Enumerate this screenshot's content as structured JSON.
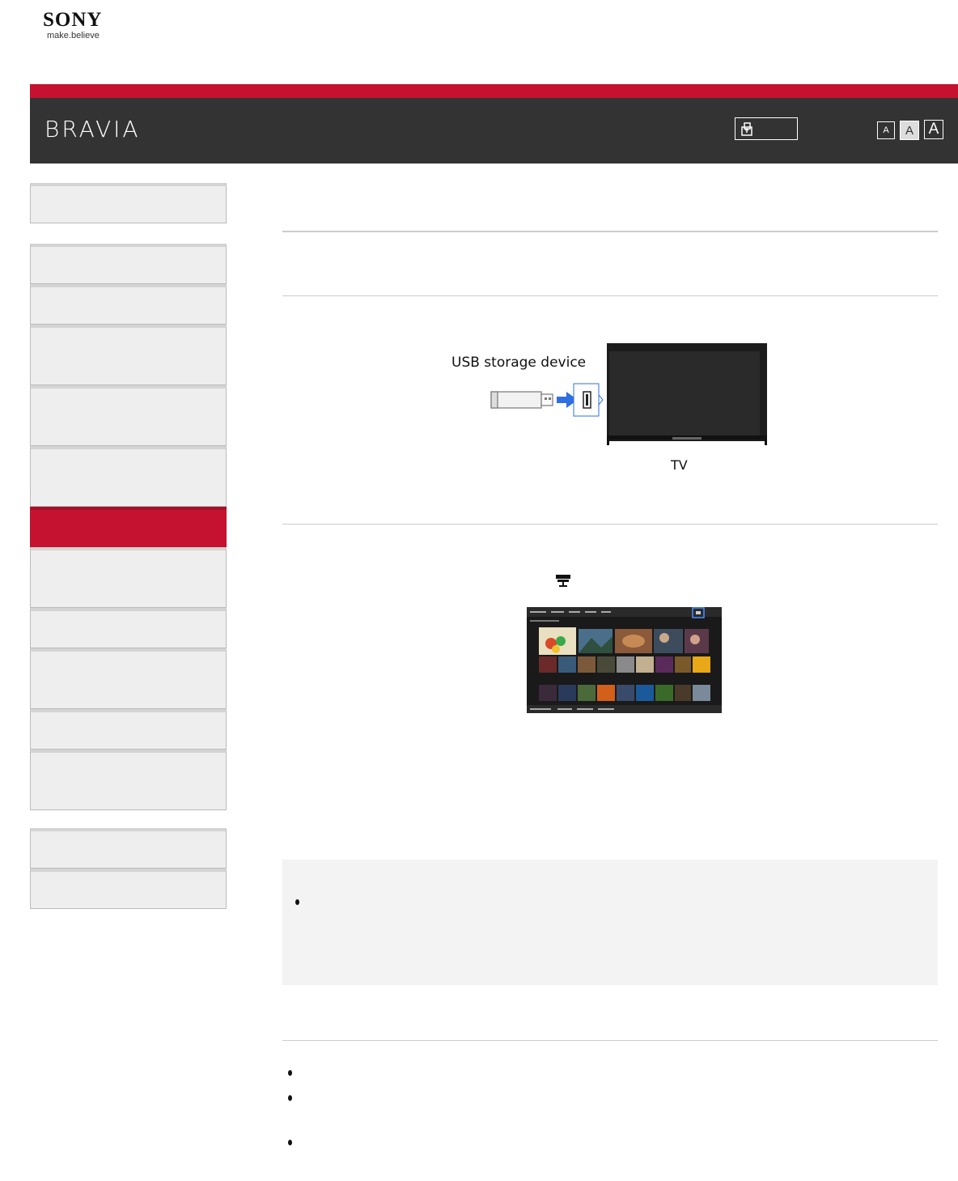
{
  "logo": {
    "brand": "SONY",
    "tagline": "make.believe"
  },
  "header": {
    "title": "BRAVIA"
  },
  "font_size_buttons": [
    "A",
    "A",
    "A"
  ],
  "sidebar": {
    "items": 14,
    "active_index": 7
  },
  "figure1": {
    "usb_label": "USB storage device",
    "tv_label": "TV"
  },
  "colors": {
    "accent": "#c41230",
    "header_bg": "#333333",
    "nav_bg": "#eeeeee",
    "note_bg": "#f3f3f3",
    "arrow": "#2f6fe0"
  },
  "icons": [
    "print-icon",
    "input-select-icon"
  ]
}
